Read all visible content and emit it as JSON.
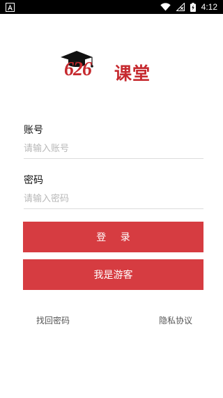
{
  "status_bar": {
    "time": "4:12",
    "icons": [
      "notification-a-icon",
      "wifi-icon",
      "no-signal-icon",
      "battery-charging-icon"
    ]
  },
  "logo": {
    "number": "626",
    "text": "课堂",
    "color": "#c62a2f",
    "icon": "graduation-cap-icon"
  },
  "form": {
    "account_label": "账号",
    "account_placeholder": "请输入账号",
    "account_value": "",
    "password_label": "密码",
    "password_placeholder": "请输入密码",
    "password_value": ""
  },
  "buttons": {
    "login_label": "登 录",
    "guest_label": "我是游客",
    "color": "#d63c41"
  },
  "links": {
    "forgot_password": "找回密码",
    "privacy_policy": "隐私协议"
  }
}
